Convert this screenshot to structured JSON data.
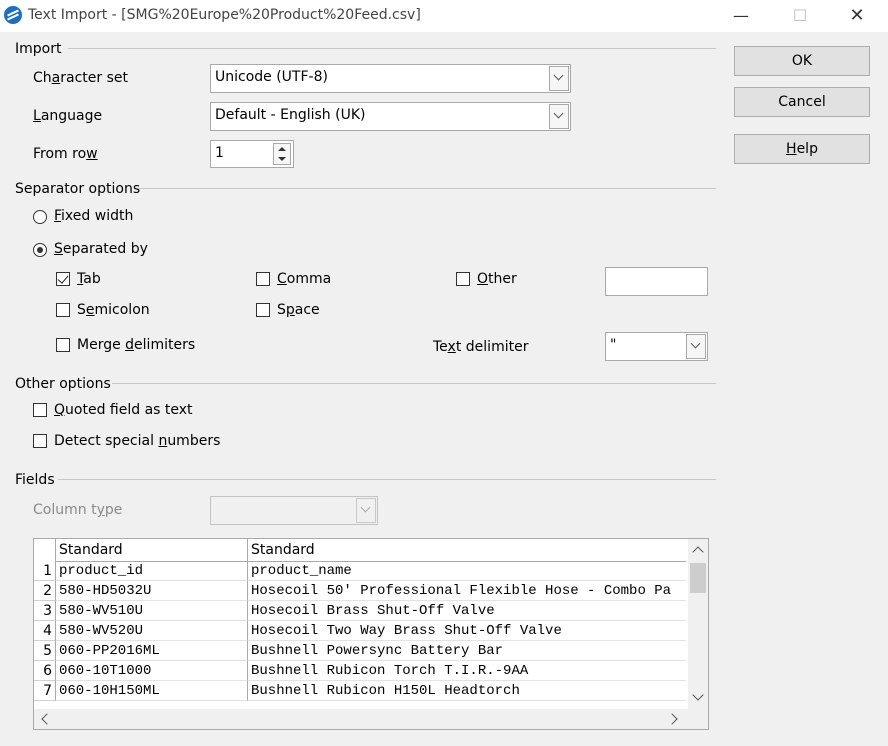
{
  "window": {
    "title": "Text Import - [SMG%20Europe%20Product%20Feed.csv]",
    "min_glyph": "—",
    "max_glyph": "☐",
    "close_glyph": "✕"
  },
  "import": {
    "header": "Import",
    "charset_label_pre": "Ch",
    "charset_label_key": "a",
    "charset_label_post": "racter set",
    "charset_value": "Unicode (UTF-8)",
    "language_label_key": "L",
    "language_label_post": "anguage",
    "language_value": "Default - English (UK)",
    "fromrow_label_pre": "From ro",
    "fromrow_label_key": "w",
    "fromrow_value": "1"
  },
  "separator": {
    "header": "Separator options",
    "fixed_key": "F",
    "fixed_post": "ixed width",
    "separated_key": "S",
    "separated_post": "eparated by",
    "tab_key": "T",
    "tab_post": "ab",
    "comma_key": "C",
    "comma_post": "omma",
    "other_key": "O",
    "other_post": "ther",
    "semicolon_pre": "S",
    "semicolon_key": "e",
    "semicolon_post": "micolon",
    "space_pre": "S",
    "space_key": "p",
    "space_post": "ace",
    "merge_pre": "Merge ",
    "merge_key": "d",
    "merge_post": "elimiters",
    "textdelim_pre": "Te",
    "textdelim_key": "x",
    "textdelim_post": "t delimiter",
    "textdelim_value": "\"",
    "other_value": ""
  },
  "other": {
    "header": "Other options",
    "quoted_key": "Q",
    "quoted_post": "uoted field as text",
    "detect_pre": "Detect special ",
    "detect_key": "n",
    "detect_post": "umbers"
  },
  "fields": {
    "header": "Fields",
    "coltype_pre": "Column t",
    "coltype_key": "y",
    "coltype_post": "pe",
    "coltype_value": "",
    "columns": [
      "Standard",
      "Standard"
    ],
    "rows": [
      {
        "n": "1",
        "a": "product_id",
        "b": "product_name"
      },
      {
        "n": "2",
        "a": "580-HD5032U",
        "b": "Hosecoil 50' Professional Flexible Hose - Combo Pa"
      },
      {
        "n": "3",
        "a": "580-WV510U",
        "b": "Hosecoil Brass Shut-Off Valve"
      },
      {
        "n": "4",
        "a": "580-WV520U",
        "b": "Hosecoil Two Way Brass Shut-Off Valve"
      },
      {
        "n": "5",
        "a": "060-PP2016ML",
        "b": "Bushnell Powersync Battery Bar"
      },
      {
        "n": "6",
        "a": "060-10T1000",
        "b": "Bushnell Rubicon Torch T.I.R.-9AA"
      },
      {
        "n": "7",
        "a": "060-10H150ML",
        "b": "Bushnell Rubicon H150L Headtorch"
      }
    ]
  },
  "buttons": {
    "ok": "OK",
    "cancel": "Cancel",
    "help_key": "H",
    "help_post": "elp"
  }
}
